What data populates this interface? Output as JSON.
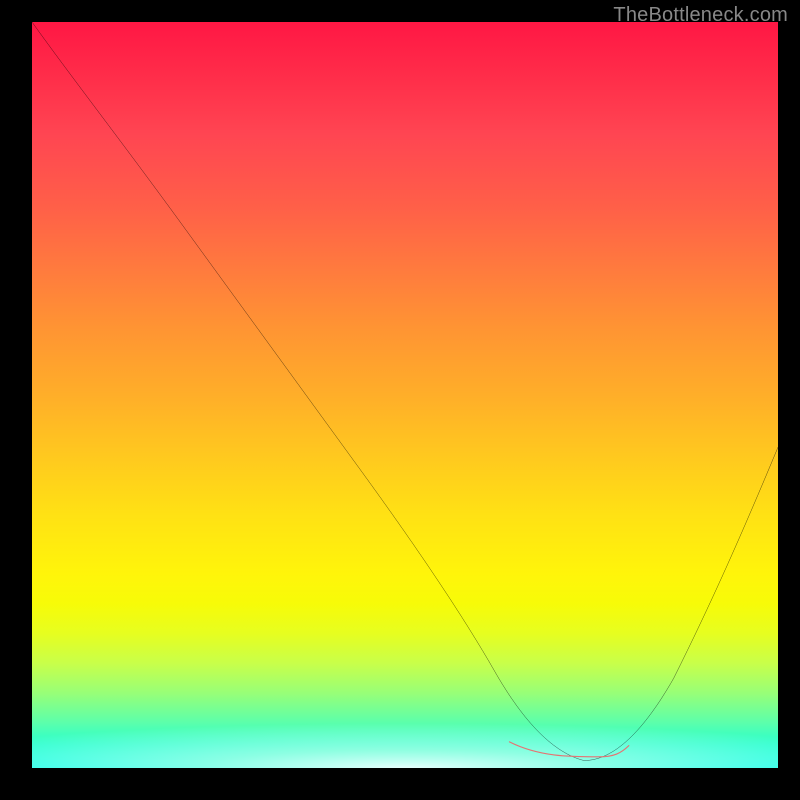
{
  "watermark": "TheBottleneck.com",
  "chart_data": {
    "type": "line",
    "title": "",
    "xlabel": "",
    "ylabel": "",
    "xlim": [
      0,
      100
    ],
    "ylim": [
      0,
      100
    ],
    "grid": false,
    "legend": false,
    "series": [
      {
        "name": "bottleneck-curve",
        "x": [
          0,
          5,
          12,
          20,
          28,
          36,
          44,
          52,
          58,
          62,
          66,
          70,
          74,
          78,
          82,
          86,
          91,
          95,
          100
        ],
        "y": [
          100,
          93,
          84,
          73,
          62,
          51,
          40,
          29,
          20,
          13,
          6,
          2,
          1,
          1,
          5,
          12,
          22,
          31,
          43
        ],
        "stroke": "#000000",
        "stroke_width": 1.6
      },
      {
        "name": "optimal-range-highlight",
        "x": [
          64,
          68,
          72,
          76,
          80
        ],
        "y": [
          3.5,
          1.5,
          1.5,
          1.5,
          3.0
        ],
        "stroke": "#e57373",
        "stroke_width": 9
      }
    ],
    "gradient_stops": [
      {
        "pos": 0,
        "color": "#ff1744"
      },
      {
        "pos": 50,
        "color": "#ffc81f"
      },
      {
        "pos": 100,
        "color": "#05ffe8"
      }
    ],
    "annotations": []
  }
}
